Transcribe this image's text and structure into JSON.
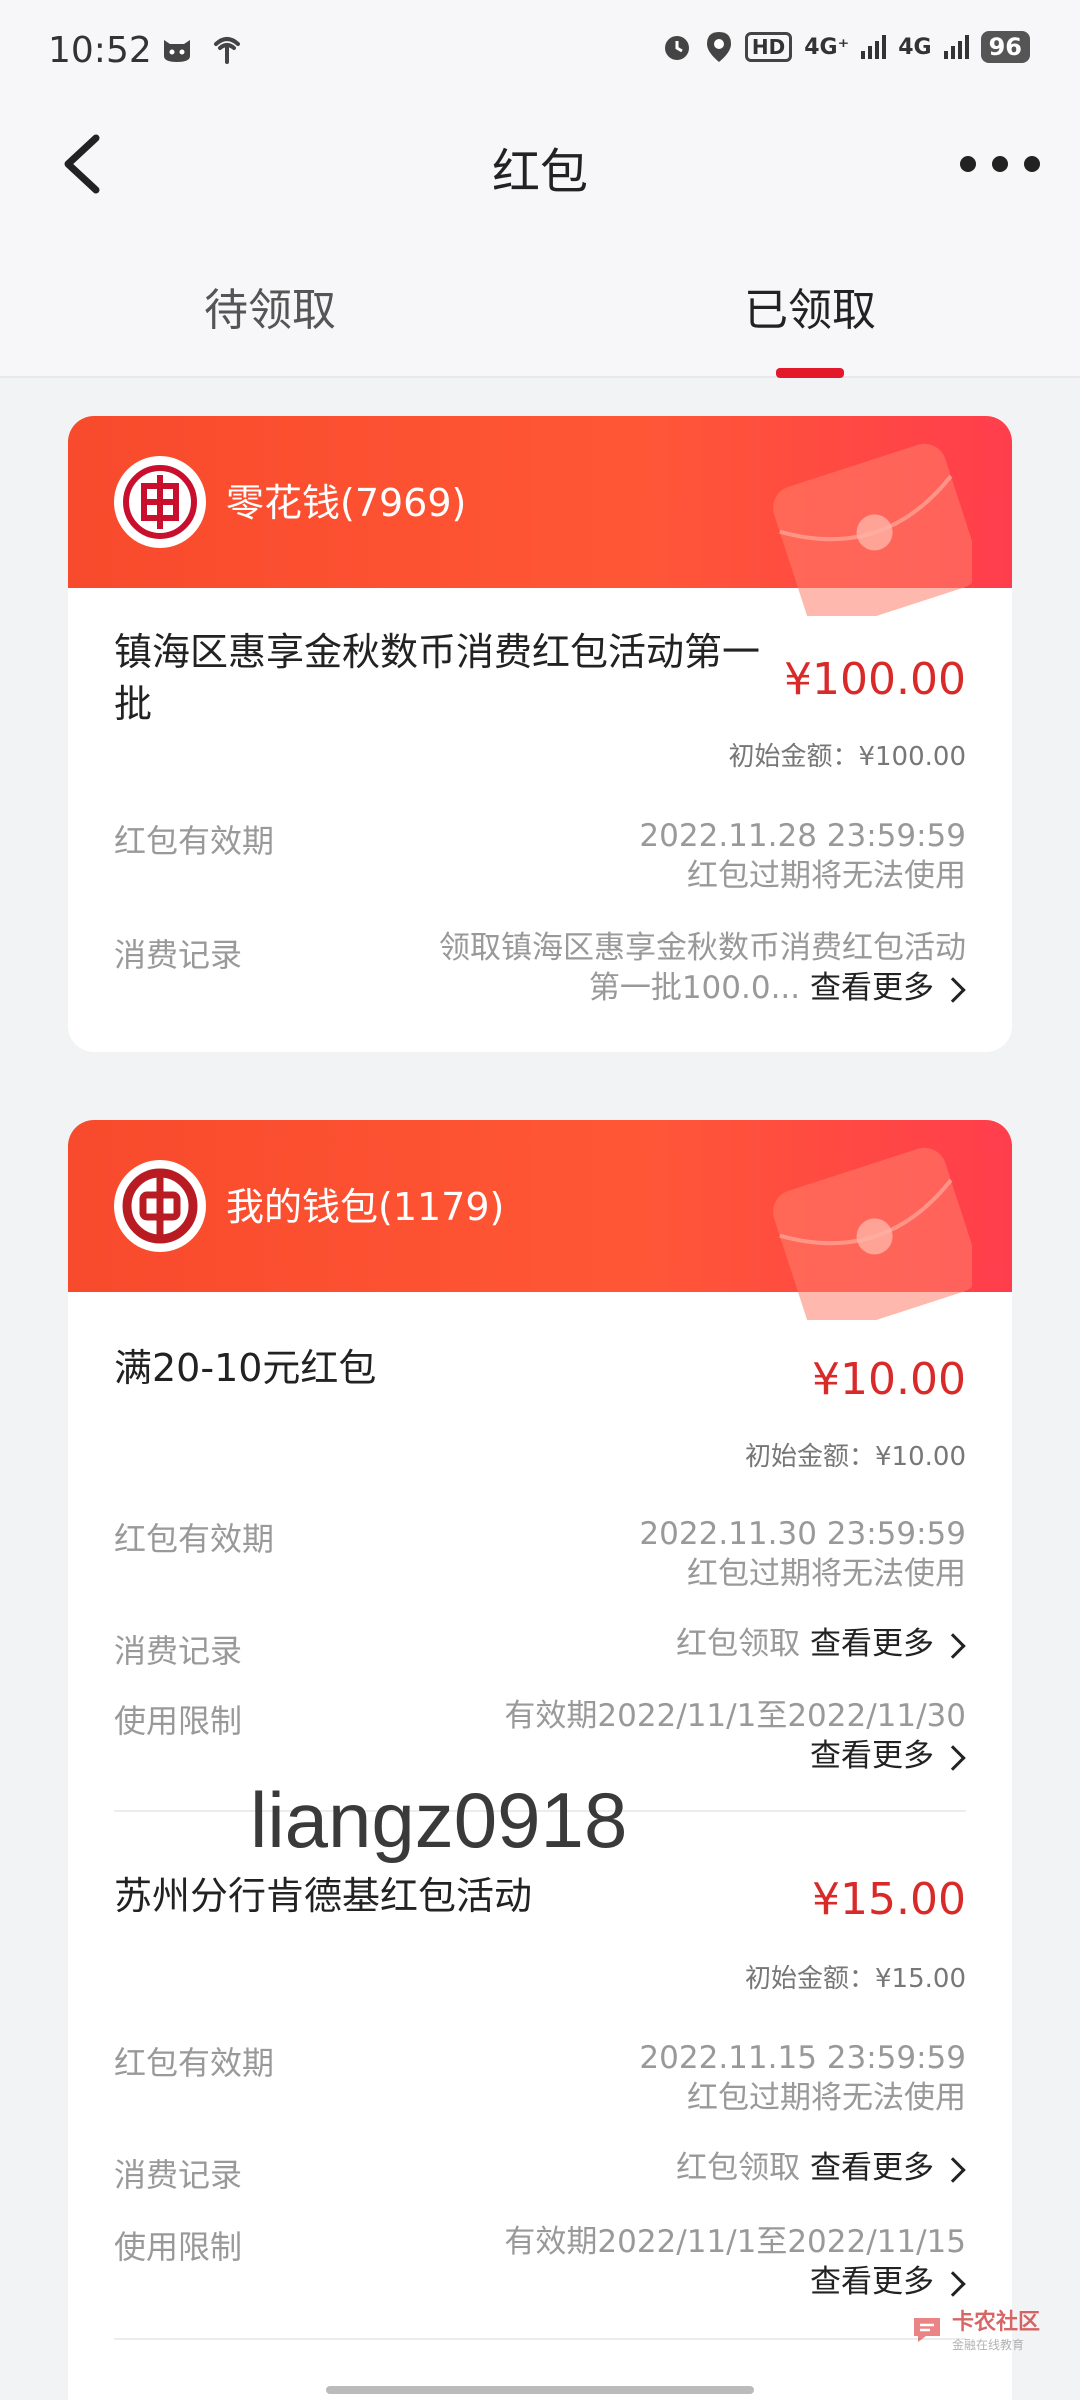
{
  "status": {
    "time": "10:52",
    "battery": "96",
    "net1": "4G⁺",
    "net2": "4G",
    "hd": "HD"
  },
  "nav": {
    "title": "红包"
  },
  "tabs": {
    "pending": "待领取",
    "received": "已领取"
  },
  "cards": [
    {
      "wallet": "零花钱(7969)",
      "items": [
        {
          "title": "镇海区惠享金秋数币消费红包活动第一批",
          "amount": "¥100.00",
          "initial": "初始金额：¥100.00",
          "validity_label": "红包有效期",
          "validity_date": "2022.11.28 23:59:59",
          "validity_note": "红包过期将无法使用",
          "record_label": "消费记录",
          "record_line1": "领取镇海区惠享金秋数币消费红包活动",
          "record_line2": "第一批100.0...",
          "more": "查看更多"
        }
      ]
    },
    {
      "wallet": "我的钱包(1179)",
      "items": [
        {
          "title": "满20-10元红包",
          "amount": "¥10.00",
          "initial": "初始金额：¥10.00",
          "validity_label": "红包有效期",
          "validity_date": "2022.11.30 23:59:59",
          "validity_note": "红包过期将无法使用",
          "record_label": "消费记录",
          "record_text": "红包领取",
          "more": "查看更多",
          "limit_label": "使用限制",
          "limit_text": "有效期2022/11/1至2022/11/30"
        },
        {
          "title": "苏州分行肯德基红包活动",
          "amount": "¥15.00",
          "initial": "初始金额：¥15.00",
          "validity_label": "红包有效期",
          "validity_date": "2022.11.15 23:59:59",
          "validity_note": "红包过期将无法使用",
          "record_label": "消费记录",
          "record_text": "红包领取",
          "more": "查看更多",
          "limit_label": "使用限制",
          "limit_text": "有效期2022/11/1至2022/11/15"
        }
      ]
    }
  ],
  "watermark": "liangz0918",
  "corner_logo": {
    "name": "卡农社区",
    "tagline": "金融在线教育"
  },
  "colors": {
    "accent_red": "#e3192b",
    "amount_red": "#d92a2a",
    "header_orange": "#ff5736"
  }
}
